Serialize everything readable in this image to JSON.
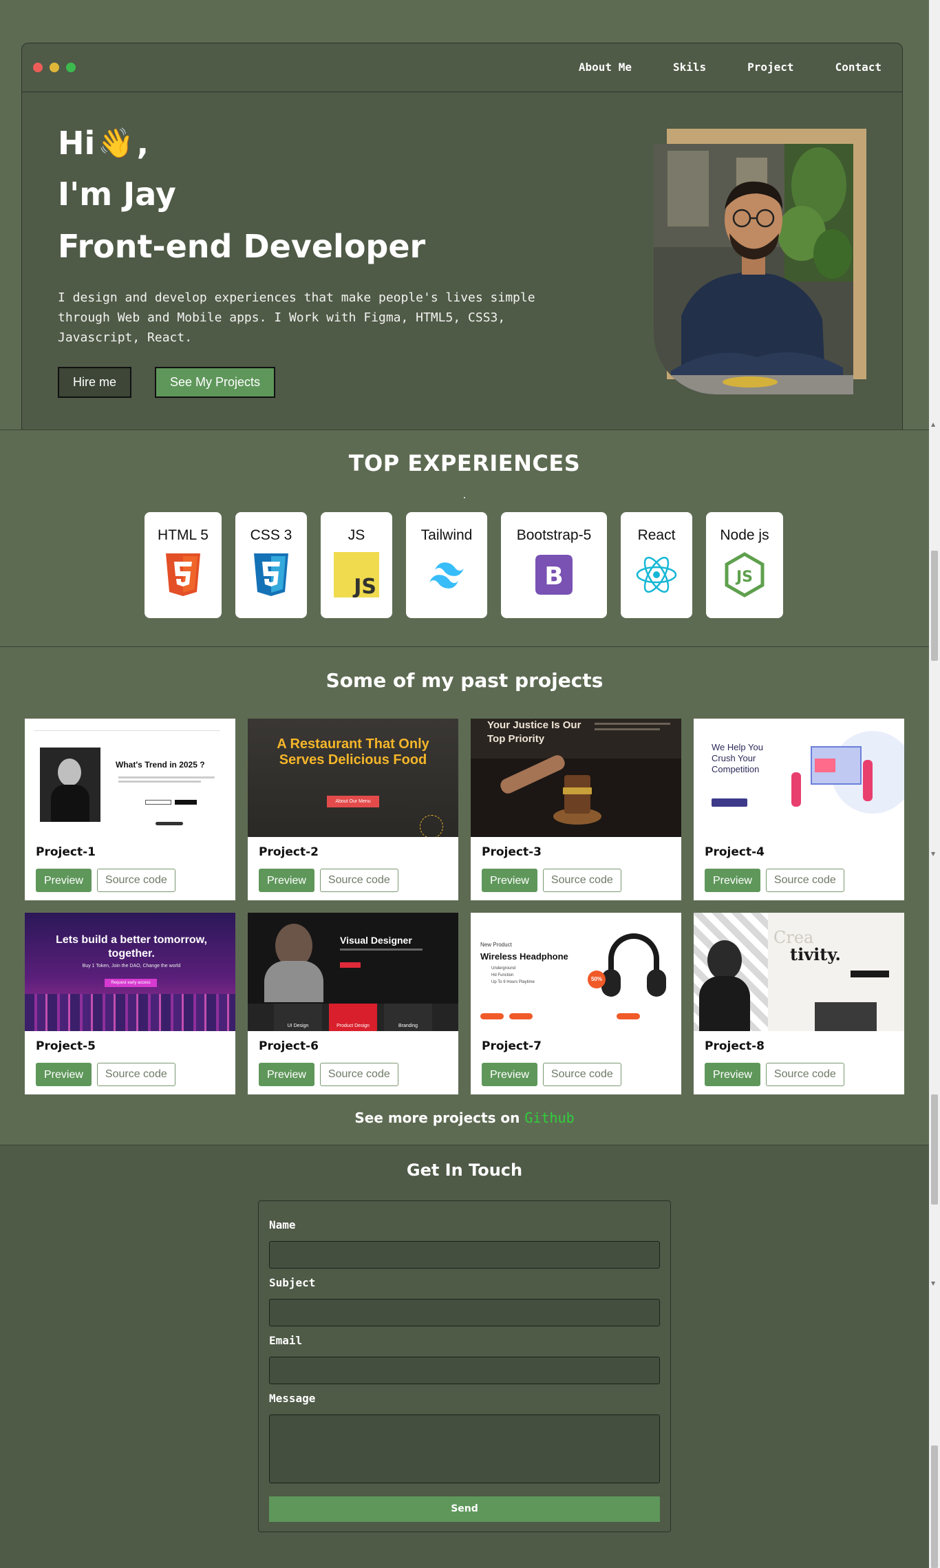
{
  "nav": {
    "items": [
      "About Me",
      "Skils",
      "Project",
      "Contact"
    ],
    "dots": [
      "#ed5d58",
      "#e1b739",
      "#3dba4e"
    ]
  },
  "hero": {
    "hi": "Hi",
    "hand": "👋",
    "comma": ",",
    "name": "I'm Jay",
    "role": "Front-end Developer",
    "description": "I design and develop experiences that make people's lives simple through Web and Mobile apps. I Work with Figma, HTML5, CSS3, Javascript, React.",
    "hire_label": "Hire me",
    "projects_label": "See My Projects"
  },
  "experiences": {
    "title": "TOP EXPERIENCES",
    "skills": [
      {
        "label": "HTML 5",
        "icon": "html5-icon"
      },
      {
        "label": "CSS 3",
        "icon": "css3-icon"
      },
      {
        "label": "JS",
        "icon": "javascript-icon"
      },
      {
        "label": "Tailwind",
        "icon": "tailwind-icon"
      },
      {
        "label": "Bootstrap-5",
        "icon": "bootstrap-icon"
      },
      {
        "label": "React",
        "icon": "react-icon"
      },
      {
        "label": "Node js",
        "icon": "nodejs-icon"
      }
    ]
  },
  "projects": {
    "title": "Some of my past projects",
    "preview_label": "Preview",
    "source_label": "Source code",
    "items": [
      {
        "name": "Project-1",
        "thumb": {
          "headline": "What's Trend in 2025 ?"
        }
      },
      {
        "name": "Project-2",
        "thumb": {
          "headline": "A Restaurant That Only Serves Delicious Food",
          "cta": "About Our Menu"
        }
      },
      {
        "name": "Project-3",
        "thumb": {
          "headline": "Your Justice Is Our Top Priority"
        }
      },
      {
        "name": "Project-4",
        "thumb": {
          "headline": "We Help You Crush Your Competition"
        }
      },
      {
        "name": "Project-5",
        "thumb": {
          "headline": "Lets build a better tomorrow, together.",
          "sub": "Buy 1 Token, Join the DAO, Change the world",
          "cta": "Request early access"
        }
      },
      {
        "name": "Project-6",
        "thumb": {
          "headline": "Visual Designer",
          "tabs": [
            "UI Design",
            "Product Design",
            "Branding"
          ]
        }
      },
      {
        "name": "Project-7",
        "thumb": {
          "tag": "New Product",
          "headline": "Wireless Headphone",
          "badge": "50%",
          "bullets": [
            "Underground",
            "Hd Function",
            "Up To 9 Hours Playtime"
          ]
        }
      },
      {
        "name": "Project-8",
        "thumb": {
          "headline": "tivity.",
          "faded": "Crea"
        }
      }
    ]
  },
  "github": {
    "prefix": "See more projects on",
    "link": "Github"
  },
  "contact": {
    "title": "Get In Touch",
    "name_label": "Name",
    "subject_label": "Subject",
    "email_label": "Email",
    "message_label": "Message",
    "send_label": "Send"
  }
}
